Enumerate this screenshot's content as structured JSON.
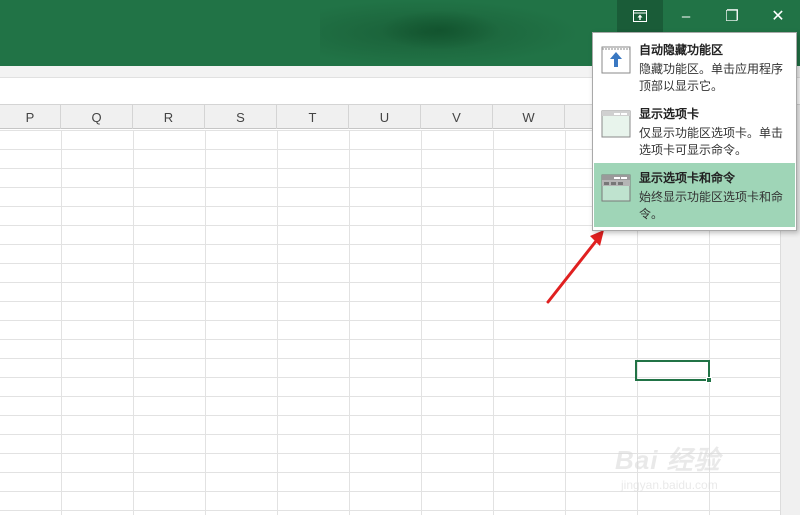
{
  "window": {
    "title_bar_color": "#217346",
    "buttons": {
      "ribbon_display_options_icon": "ribbon-display-options-icon",
      "minimize_glyph": "–",
      "restore_glyph": "❐",
      "close_glyph": "✕"
    }
  },
  "sheet": {
    "columns": [
      "P",
      "Q",
      "R",
      "S",
      "T",
      "U",
      "V",
      "W"
    ],
    "selected_cell_color": "#217346"
  },
  "ribbon_menu": {
    "items": [
      {
        "title": "自动隐藏功能区",
        "description": "隐藏功能区。单击应用程序顶部以显示它。",
        "icon": "auto-hide-ribbon-icon"
      },
      {
        "title": "显示选项卡",
        "description": "仅显示功能区选项卡。单击选项卡可显示命令。",
        "icon": "show-tabs-icon"
      },
      {
        "title": "显示选项卡和命令",
        "description": "始终显示功能区选项卡和命令。",
        "icon": "show-tabs-and-commands-icon",
        "highlighted": true,
        "highlight_color": "#9fd5b7"
      }
    ]
  },
  "annotation": {
    "arrow_color": "#e02020"
  },
  "watermark": {
    "main": "Bai 经验",
    "sub": "jingyan.baidu.com"
  }
}
